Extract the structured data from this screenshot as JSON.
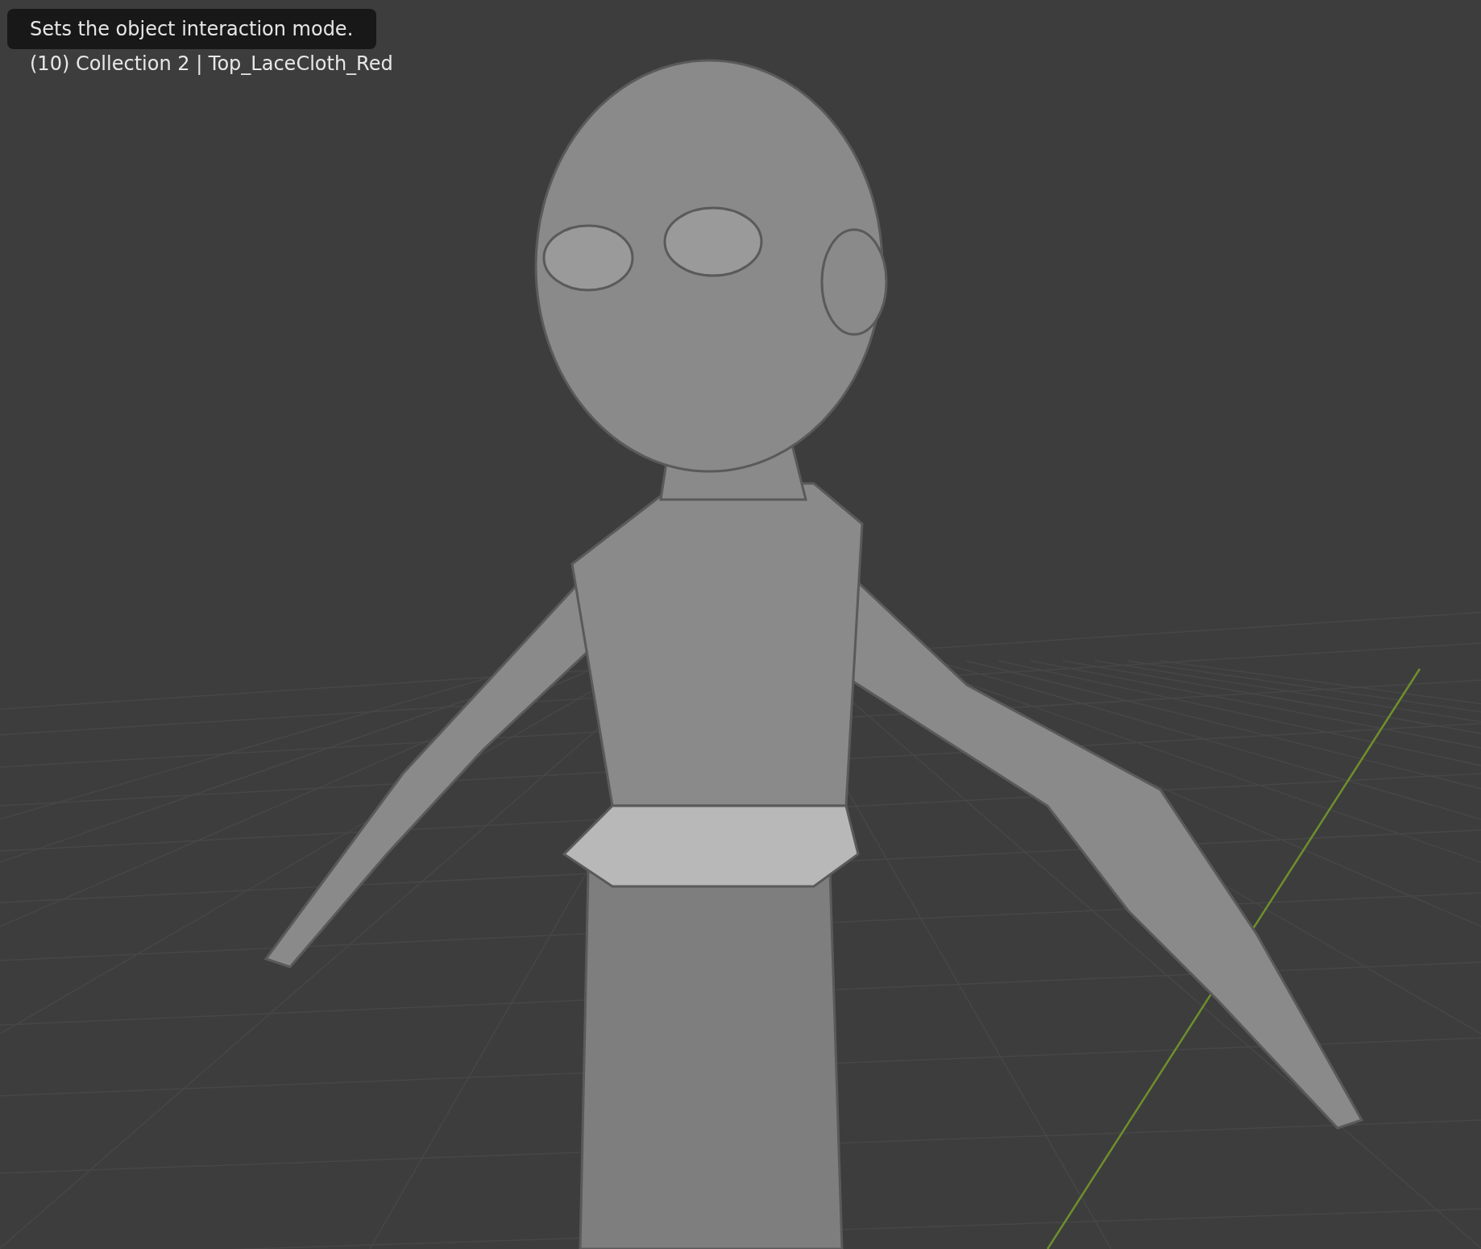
{
  "viewport": {
    "object_info": "(10) Collection 2 | Top_LaceCloth_Red"
  },
  "tooltip": {
    "text": "Sets the object interaction mode."
  }
}
